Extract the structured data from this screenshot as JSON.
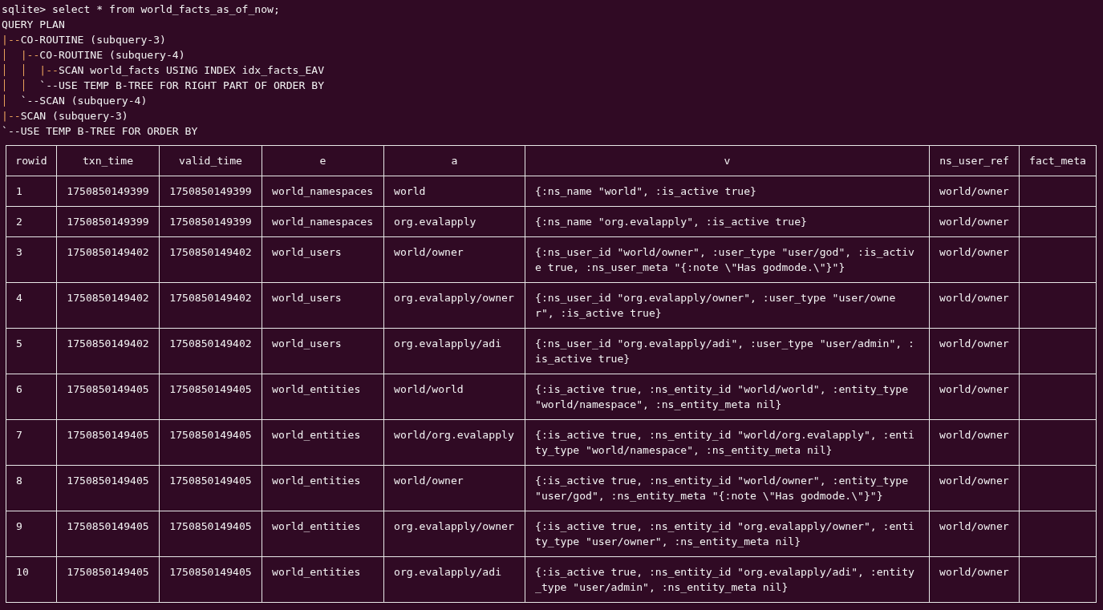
{
  "prompt": {
    "label": "sqlite>",
    "command": "select * from world_facts_as_of_now;"
  },
  "query_plan": {
    "title": "QUERY PLAN",
    "children": [
      {
        "branch": "|--",
        "text": "CO-ROUTINE (subquery-3)",
        "children": [
          {
            "branch": "|--",
            "text": "CO-ROUTINE (subquery-4)",
            "children": [
              {
                "branch": "|--",
                "text": "SCAN world_facts USING INDEX idx_facts_EAV"
              },
              {
                "branch": "`--",
                "text": "USE TEMP B-TREE FOR RIGHT PART OF ORDER BY"
              }
            ]
          },
          {
            "branch": "`--",
            "text": "SCAN (subquery-4)"
          }
        ]
      },
      {
        "branch": "|--",
        "text": "SCAN (subquery-3)"
      },
      {
        "branch": "`--",
        "text": "USE TEMP B-TREE FOR ORDER BY"
      }
    ]
  },
  "table": {
    "columns": [
      "rowid",
      "txn_time",
      "valid_time",
      "e",
      "a",
      "v",
      "ns_user_ref",
      "fact_meta"
    ],
    "rows": [
      [
        "1",
        "1750850149399",
        "1750850149399",
        "world_namespaces",
        "world",
        "{:ns_name \"world\", :is_active true}",
        "world/owner"
      ],
      [
        "2",
        "1750850149399",
        "1750850149399",
        "world_namespaces",
        "org.evalapply",
        "{:ns_name \"org.evalapply\", :is_active true}",
        "world/owner"
      ],
      [
        "3",
        "1750850149402",
        "1750850149402",
        "world_users",
        "world/owner",
        "{:ns_user_id \"world/owner\", :user_type \"user/god\", :is_active true, :ns_user_meta \"{:note \\\"Has godmode.\\\"}\"}",
        "world/owner"
      ],
      [
        "4",
        "1750850149402",
        "1750850149402",
        "world_users",
        "org.evalapply/owner",
        "{:ns_user_id \"org.evalapply/owner\", :user_type \"user/owner\", :is_active true}",
        "world/owner"
      ],
      [
        "5",
        "1750850149402",
        "1750850149402",
        "world_users",
        "org.evalapply/adi",
        "{:ns_user_id \"org.evalapply/adi\", :user_type \"user/admin\", :is_active true}",
        "world/owner"
      ],
      [
        "6",
        "1750850149405",
        "1750850149405",
        "world_entities",
        "world/world",
        "{:is_active true, :ns_entity_id \"world/world\", :entity_type \"world/namespace\", :ns_entity_meta nil}",
        "world/owner"
      ],
      [
        "7",
        "1750850149405",
        "1750850149405",
        "world_entities",
        "world/org.evalapply",
        "{:is_active true, :ns_entity_id \"world/org.evalapply\", :entity_type \"world/namespace\", :ns_entity_meta nil}",
        "world/owner"
      ],
      [
        "8",
        "1750850149405",
        "1750850149405",
        "world_entities",
        "world/owner",
        "{:is_active true, :ns_entity_id \"world/owner\", :entity_type \"user/god\", :ns_entity_meta \"{:note \\\"Has godmode.\\\"}\"}",
        "world/owner"
      ],
      [
        "9",
        "1750850149405",
        "1750850149405",
        "world_entities",
        "org.evalapply/owner",
        "{:is_active true, :ns_entity_id \"org.evalapply/owner\", :entity_type \"user/owner\", :ns_entity_meta nil}",
        "world/owner"
      ],
      [
        "10",
        "1750850149405",
        "1750850149405",
        "world_entities",
        "org.evalapply/adi",
        "{:is_active true, :ns_entity_id \"org.evalapply/adi\", :entity_type \"user/admin\", :ns_entity_meta nil}",
        "world/owner"
      ]
    ]
  }
}
